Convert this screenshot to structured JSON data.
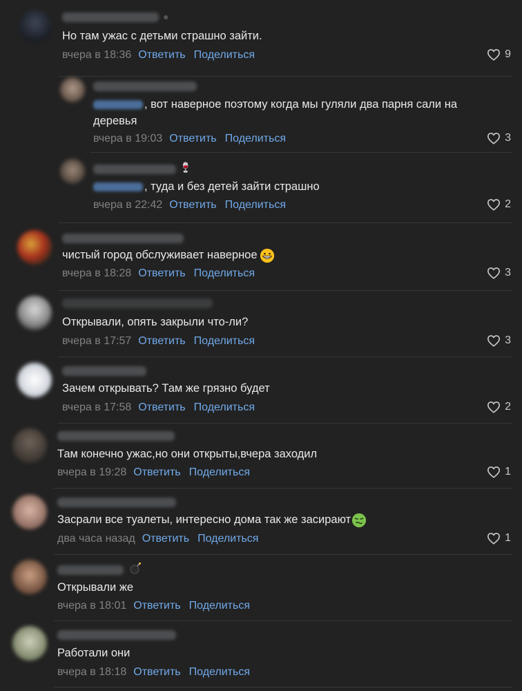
{
  "comments": [
    {
      "text": "Но там ужас с детьми страшно зайти.",
      "time": "вчера в 18:36",
      "reply": "Ответить",
      "share": "Поделиться",
      "likes": "9"
    },
    {
      "text": ", вот наверное поэтому когда мы гуляли два парня сали на",
      "text2": "деревья",
      "time": "вчера в 19:03",
      "reply": "Ответить",
      "share": "Поделиться",
      "likes": "3"
    },
    {
      "text": ", туда и без детей зайти страшно",
      "time": "вчера в 22:42",
      "reply": "Ответить",
      "share": "Поделиться",
      "likes": "2"
    },
    {
      "text": "чистый город обслуживает наверное",
      "time": "вчера в 18:28",
      "reply": "Ответить",
      "share": "Поделиться",
      "likes": "3"
    },
    {
      "text": "Открывали, опять закрыли что-ли?",
      "time": "вчера в 17:57",
      "reply": "Ответить",
      "share": "Поделиться",
      "likes": "3"
    },
    {
      "text": "Зачем открывать? Там же грязно будет",
      "time": "вчера в 17:58",
      "reply": "Ответить",
      "share": "Поделиться",
      "likes": "2"
    },
    {
      "text": "Там конечно ужас,но они открыты,вчера заходил",
      "time": "вчера в 19:28",
      "reply": "Ответить",
      "share": "Поделиться",
      "likes": "1"
    },
    {
      "text": "Засрали все туалеты, интересно дома так же засирают",
      "time": "два часа назад",
      "reply": "Ответить",
      "share": "Поделиться",
      "likes": "1"
    },
    {
      "text": "Открывали же",
      "time": "вчера в 18:01",
      "reply": "Ответить",
      "share": "Поделиться",
      "likes": ""
    },
    {
      "text": "Работали они",
      "time": "вчера в 18:18",
      "reply": "Ответить",
      "share": "Поделиться",
      "likes": ""
    }
  ],
  "colors": {
    "background": "#222222",
    "link": "#71aaeb",
    "time": "#828282",
    "text": "#e8e9eb",
    "divider": "#363738"
  }
}
